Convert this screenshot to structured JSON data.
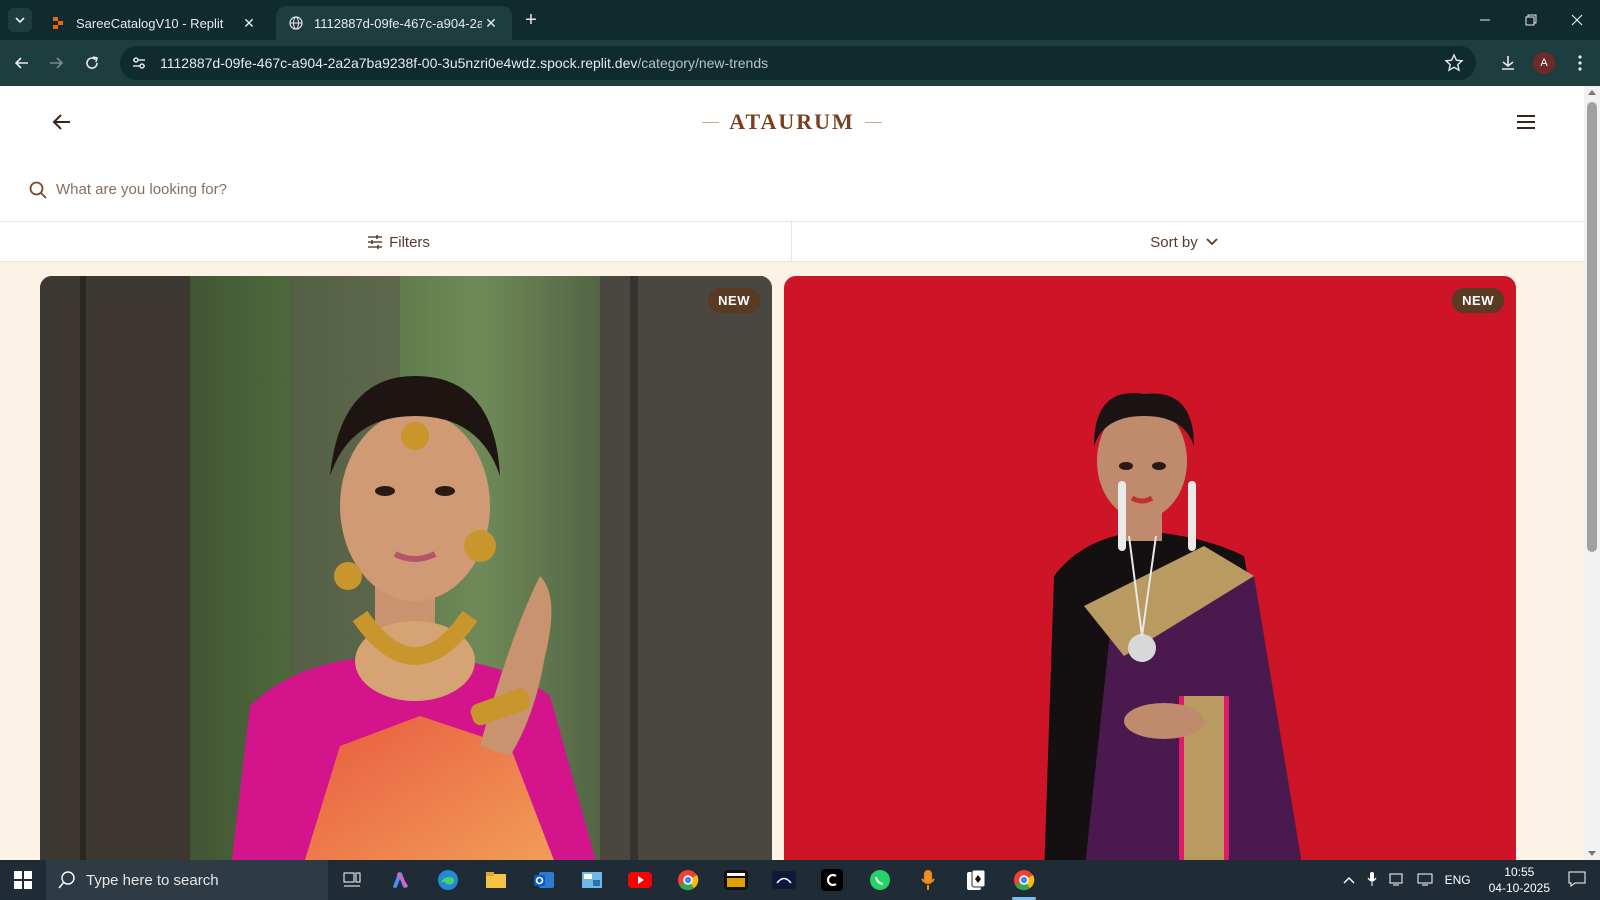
{
  "browser": {
    "tabs": [
      {
        "title": "SareeCatalogV10 - Replit",
        "active": false
      },
      {
        "title": "1112887d-09fe-467c-a904-2a2",
        "active": true
      }
    ],
    "url_main": "1112887d-09fe-467c-a904-2a2a7ba9238f-00-3u5nzri0e4wdz.spock.replit.dev",
    "url_path": "/category/new-trends",
    "profile_initial": "A"
  },
  "site": {
    "brand": "ATAURUM",
    "search_placeholder": "What are you looking for?",
    "filters_label": "Filters",
    "sort_label": "Sort by",
    "colors": {
      "accent": "#7a3f1f",
      "cream": "#fdf2e6",
      "badge": "#5a3a22"
    }
  },
  "products": [
    {
      "badge": "NEW",
      "image": "model in pink blouse and orange silk saree with gold jewellery, forest background"
    },
    {
      "badge": "NEW",
      "image": "model in purple saree with gold border, red background"
    }
  ],
  "taskbar": {
    "search_hint": "Type here to search",
    "language": "ENG",
    "time": "10:55",
    "date": "04-10-2025"
  }
}
